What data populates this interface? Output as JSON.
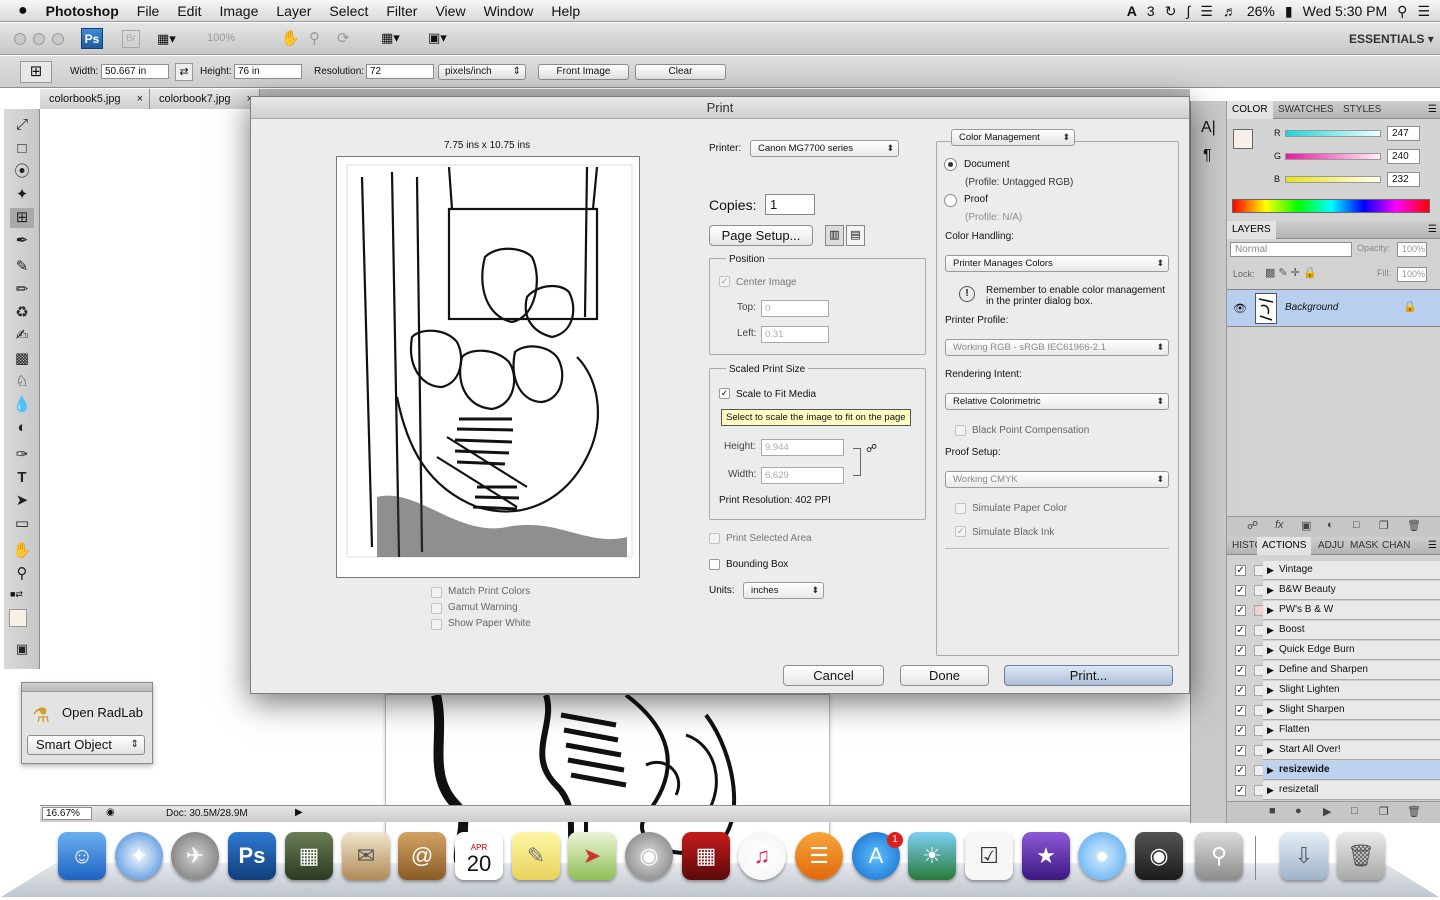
{
  "menubar": {
    "apple": "",
    "app": "Photoshop",
    "items": [
      "File",
      "Edit",
      "Image",
      "Layer",
      "Select",
      "Filter",
      "View",
      "Window",
      "Help"
    ],
    "status": {
      "notif": "3",
      "battery": "26%",
      "clock": "Wed 5:30 PM"
    }
  },
  "appbar": {
    "ps": "Ps",
    "br": "Br",
    "zoom": "100%",
    "workspace": "ESSENTIALS"
  },
  "options": {
    "width_label": "Width:",
    "width_value": "50.667 in",
    "height_label": "Height:",
    "height_value": "76 in",
    "resolution_label": "Resolution:",
    "resolution_value": "72",
    "units": "pixels/inch",
    "front_image": "Front Image",
    "clear": "Clear"
  },
  "tabs": [
    "colorbook5.jpg",
    "colorbook7.jpg"
  ],
  "status": {
    "zoom": "16.67%",
    "doc": "Doc: 30.5M/28.9M"
  },
  "radlab": {
    "open": "Open RadLab",
    "mode": "Smart Object"
  },
  "panels": {
    "color_tabs": [
      "COLOR",
      "SWATCHES",
      "STYLES"
    ],
    "r": {
      "label": "R",
      "value": "247"
    },
    "g": {
      "label": "G",
      "value": "240"
    },
    "b": {
      "label": "B",
      "value": "232"
    },
    "layers_tab": "LAYERS",
    "blend_mode": "Normal",
    "opacity_label": "Opacity:",
    "opacity_value": "100%",
    "lock_label": "Lock:",
    "fill_label": "Fill:",
    "fill_value": "100%",
    "layer_name": "Background",
    "bottom_tabs": [
      "HISTO",
      "ACTIONS",
      "ADJU",
      "MASK",
      "CHAN"
    ],
    "actions": [
      "Vintage",
      "B&W Beauty",
      "PW's B & W",
      "Boost",
      "Quick Edge Burn",
      "Define and Sharpen",
      "Slight Lighten",
      "Slight Sharpen",
      "Flatten",
      "Start All Over!",
      "resizewide",
      "resizetall"
    ]
  },
  "dialog": {
    "title": "Print",
    "paper_size": "7.75 ins x 10.75 ins",
    "match_print_colors": "Match Print Colors",
    "gamut_warning": "Gamut Warning",
    "show_paper_white": "Show Paper White",
    "printer_label": "Printer:",
    "printer_value": "Canon MG7700 series",
    "copies_label": "Copies:",
    "copies_value": "1",
    "page_setup": "Page Setup...",
    "position_title": "Position",
    "center_image": "Center Image",
    "top_label": "Top:",
    "top_value": "0",
    "left_label": "Left:",
    "left_value": "0.31",
    "scaled_title": "Scaled Print Size",
    "scale_to_fit": "Scale to Fit Media",
    "tooltip": "Select to scale the image to fit on the page",
    "height_label": "Height:",
    "height_value": "9.944",
    "width_label": "Width:",
    "width_value": "6.629",
    "print_resolution": "Print Resolution: 402 PPI",
    "print_selected_area": "Print Selected Area",
    "bounding_box": "Bounding Box",
    "units_label": "Units:",
    "units_value": "inches",
    "color_management": "Color Management",
    "document": "Document",
    "document_profile": "(Profile: Untagged RGB)",
    "proof": "Proof",
    "proof_profile": "(Profile: N/A)",
    "color_handling_label": "Color Handling:",
    "color_handling_value": "Printer Manages Colors",
    "remember_note": "Remember to enable color management in the printer dialog box.",
    "printer_profile_label": "Printer Profile:",
    "printer_profile_value": "Working RGB - sRGB IEC61966-2.1",
    "rendering_intent_label": "Rendering Intent:",
    "rendering_intent_value": "Relative Colorimetric",
    "black_point": "Black Point Compensation",
    "proof_setup_label": "Proof Setup:",
    "proof_setup_value": "Working CMYK",
    "simulate_paper": "Simulate Paper Color",
    "simulate_ink": "Simulate Black Ink",
    "cancel": "Cancel",
    "done": "Done",
    "print": "Print..."
  },
  "dock": {
    "calendar_month": "APR",
    "calendar_day": "20",
    "ps": "Ps",
    "appstore_badge": "1"
  }
}
